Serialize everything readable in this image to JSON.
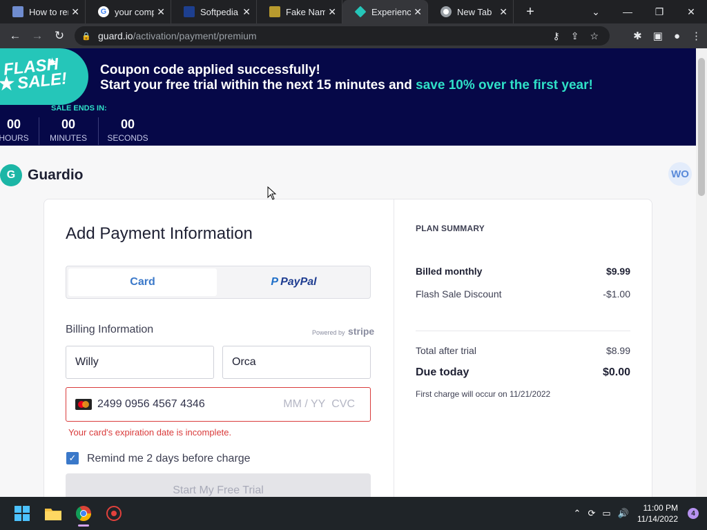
{
  "browser": {
    "tabs": [
      {
        "title": "How to rem",
        "favicon_color": "#6f8ccf"
      },
      {
        "title": "your compu",
        "favicon_color": "#ffffff"
      },
      {
        "title": "Softpedia -",
        "favicon_color": "#1d3f8f"
      },
      {
        "title": "Fake Name",
        "favicon_color": "#b89a2e"
      },
      {
        "title": "Experience",
        "favicon_color": "#25c6b9"
      },
      {
        "title": "New Tab",
        "favicon_color": "#ffffff"
      }
    ],
    "active_tab": 4,
    "url_domain": "guard.io",
    "url_path": "/activation/payment/premium"
  },
  "banner": {
    "badge_line1": "FLASH",
    "badge_line2": "SALE!",
    "line1": "Coupon code applied successfully!",
    "line2_plain": "Start your free trial within the next 15 minutes and ",
    "line2_highlight": "save 10% over the first year!",
    "sale_ends": "SALE ENDS IN:",
    "timer": [
      {
        "value": "00",
        "unit": "HOURS"
      },
      {
        "value": "00",
        "unit": "MINUTES"
      },
      {
        "value": "00",
        "unit": "SECONDS"
      }
    ]
  },
  "header": {
    "brand": "Guardio",
    "avatar_initials": "WO"
  },
  "form": {
    "title": "Add Payment Information",
    "tab_card": "Card",
    "tab_paypal": "PayPal",
    "billing_label": "Billing Information",
    "powered_by": "Powered by",
    "stripe": "stripe",
    "first_name": "Willy",
    "last_name": "Orca",
    "card_number": "2499 0956 4567 4346",
    "expiry_placeholder": "MM / YY",
    "cvc_placeholder": "CVC",
    "error": "Your card's expiration date is incomplete.",
    "remind_label": "Remind me 2 days before charge",
    "remind_checked": true,
    "submit": "Start My Free Trial"
  },
  "summary": {
    "title": "PLAN SUMMARY",
    "billed_label": "Billed monthly",
    "billed_value": "$9.99",
    "discount_label": "Flash Sale Discount",
    "discount_value": "-$1.00",
    "total_label": "Total after trial",
    "total_value": "$8.99",
    "due_label": "Due today",
    "due_value": "$0.00",
    "note": "First charge will occur on 11/21/2022"
  },
  "taskbar": {
    "time": "11:00 PM",
    "date": "11/14/2022",
    "notifications": "4"
  }
}
